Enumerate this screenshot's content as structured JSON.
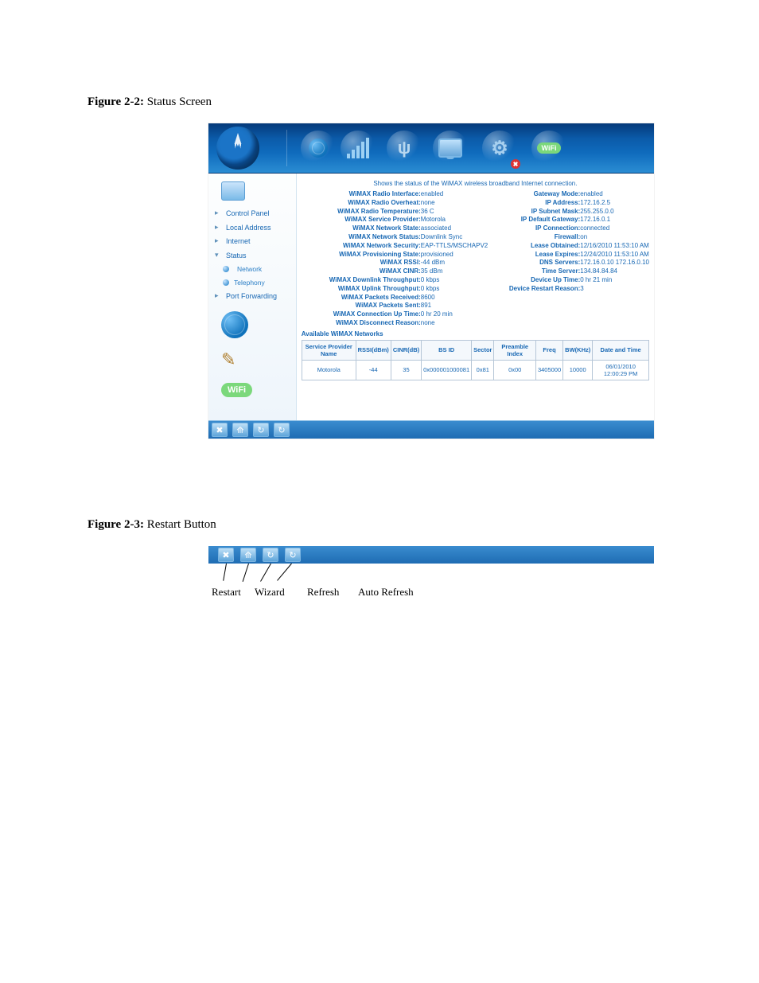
{
  "figures": {
    "f1": {
      "label": "Figure 2-2:",
      "title": "Status Screen"
    },
    "f2": {
      "label": "Figure 2-3:",
      "title": "Restart Button"
    }
  },
  "banner": "Shows the status of the WiMAX wireless broadband Internet connection.",
  "sidebar": {
    "items": [
      {
        "label": "Control Panel"
      },
      {
        "label": "Local Address"
      },
      {
        "label": "Internet"
      },
      {
        "label": "Status",
        "expanded": true
      },
      {
        "label": "Network",
        "sub": true,
        "selected": true
      },
      {
        "label": "Telephony",
        "sub": true
      },
      {
        "label": "Port Forwarding"
      }
    ]
  },
  "left_status": [
    {
      "k": "WiMAX Radio Interface:",
      "v": "enabled"
    },
    {
      "k": "WiMAX Radio Overheat:",
      "v": "none"
    },
    {
      "k": "WiMAX Radio Temperature:",
      "v": "36 C"
    },
    {
      "k": "WiMAX Service Provider:",
      "v": "Motorola"
    },
    {
      "k": "WiMAX Network State:",
      "v": "associated"
    },
    {
      "k": "WiMAX Network Status:",
      "v": "Downlink Sync"
    },
    {
      "k": "WiMAX Network Security:",
      "v": "EAP-TTLS/MSCHAPV2"
    },
    {
      "k": "WiMAX Provisioning State:",
      "v": "provisioned"
    },
    {
      "k": "WiMAX RSSI:",
      "v": "-44 dBm"
    },
    {
      "k": "WiMAX CINR:",
      "v": "35 dBm"
    },
    {
      "k": "WiMAX Downlink Throughput:",
      "v": "0 kbps"
    },
    {
      "k": "WiMAX Uplink Throughput:",
      "v": "0 kbps"
    },
    {
      "k": "WiMAX Packets Received:",
      "v": "8600"
    },
    {
      "k": "WiMAX Packets Sent:",
      "v": "891"
    },
    {
      "k": "WiMAX Connection Up Time:",
      "v": "0 hr 20 min"
    },
    {
      "k": "WiMAX Disconnect Reason:",
      "v": "none"
    }
  ],
  "right_status": [
    {
      "k": "Gateway Mode:",
      "v": "enabled"
    },
    {
      "k": "IP Address:",
      "v": "172.16.2.5"
    },
    {
      "k": "IP Subnet Mask:",
      "v": "255.255.0.0"
    },
    {
      "k": "IP Default Gateway:",
      "v": "172.16.0.1"
    },
    {
      "k": "IP Connection:",
      "v": "connected"
    },
    {
      "k": "Firewall:",
      "v": "on"
    },
    {
      "k": "Lease Obtained:",
      "v": "12/16/2010 11:53:10 AM"
    },
    {
      "k": "Lease Expires:",
      "v": "12/24/2010 11:53:10 AM"
    },
    {
      "k": "DNS Servers:",
      "v": "172.16.0.10 172.16.0.10"
    },
    {
      "k": "Time Server:",
      "v": "134.84.84.84"
    },
    {
      "k": "Device Up Time:",
      "v": "0 hr 21 min"
    },
    {
      "k": "Device Restart Reason:",
      "v": "3"
    }
  ],
  "networks_label": "Available WiMAX Networks",
  "table": {
    "headers": [
      "Service Provider Name",
      "RSSI(dBm)",
      "CINR(dB)",
      "BS ID",
      "Sector",
      "Preamble Index",
      "Freq",
      "BW(KHz)",
      "Date and Time"
    ],
    "row": [
      "Motorola",
      "-44",
      "35",
      "0x000001000081",
      "0x81",
      "0x00",
      "3405000",
      "10000",
      "06/01/2010 12:00:29 PM"
    ]
  },
  "footer_buttons": {
    "restart": "✖",
    "wizard": "⟰",
    "refresh": "↻",
    "auto_refresh": "↻"
  },
  "callouts": {
    "restart": "Restart",
    "wizard": "Wizard",
    "refresh": "Refresh",
    "auto_refresh": "Auto Refresh"
  },
  "wifi_label": "WiFi"
}
